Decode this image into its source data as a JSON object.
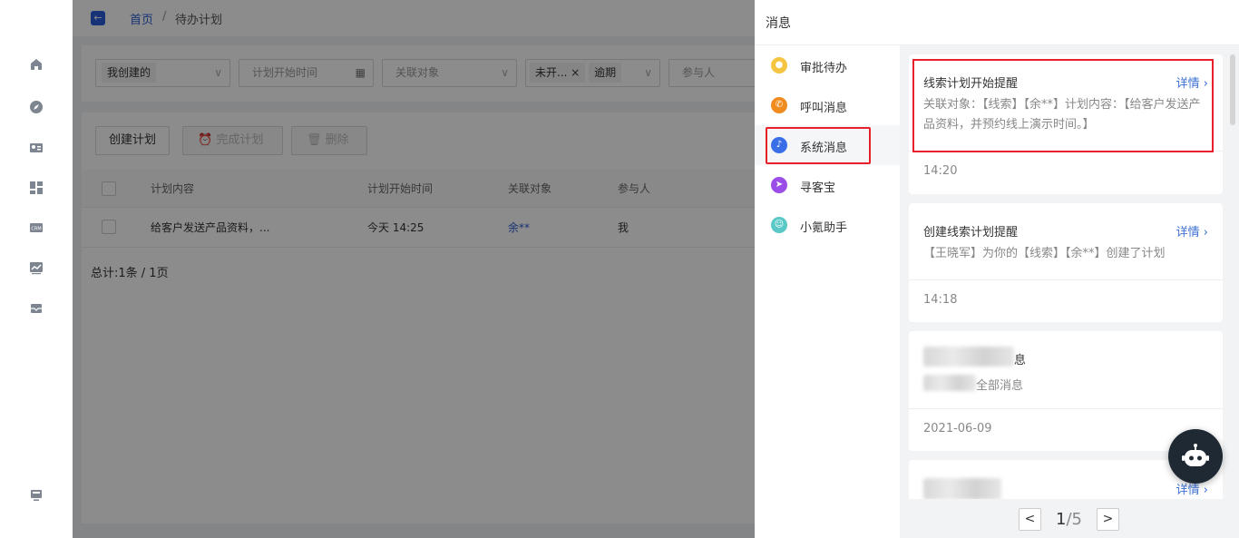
{
  "breadcrumb": {
    "home": "首页",
    "sep": "/",
    "current": "待办计划"
  },
  "filters": {
    "created_by": "我创建的",
    "start_time_placeholder": "计划开始时间",
    "related_placeholder": "关联对象",
    "status_tags": [
      "未开...",
      "逾期"
    ],
    "participants_placeholder": "参与人"
  },
  "toolbar": {
    "create": "创建计划",
    "complete": "完成计划",
    "delete": "删除"
  },
  "table": {
    "headers": [
      "计划内容",
      "计划开始时间",
      "关联对象",
      "参与人"
    ],
    "rows": [
      {
        "content": "给客户发送产品资料，...",
        "start": "今天 14:25",
        "related": "余**",
        "participant": "我"
      }
    ],
    "total": "总计:1条 / 1页"
  },
  "drawer": {
    "title": "消息",
    "categories": [
      {
        "label": "审批待办",
        "color": "#f5c542"
      },
      {
        "label": "呼叫消息",
        "color": "#f08c1e"
      },
      {
        "label": "系统消息",
        "color": "#3b6fe8"
      },
      {
        "label": "寻客宝",
        "color": "#9b4de8"
      },
      {
        "label": "小氪助手",
        "color": "#5bc8c8"
      }
    ],
    "messages": [
      {
        "title": "线索计划开始提醒",
        "detail": "详情 ›",
        "body": "关联对象：【线索】【余**】计划内容：【给客户发送产品资料，并预约线上演示时间。】",
        "time": "14:20"
      },
      {
        "title": "创建线索计划提醒",
        "detail": "详情 ›",
        "body": "【王晓军】为你的【线索】【余**】创建了计划",
        "time": "14:18"
      },
      {
        "title_suffix": "息",
        "body_suffix": "全部消息",
        "time": "2021-06-09"
      },
      {
        "detail": "详情 ›"
      }
    ],
    "pager": {
      "current": "1",
      "total": "/5",
      "prev": "<",
      "next": ">"
    }
  }
}
